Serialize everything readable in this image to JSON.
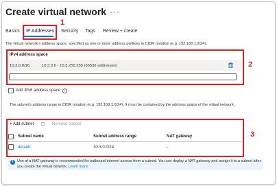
{
  "header": {
    "title": "Create virtual network",
    "more_label": "···"
  },
  "tabs": [
    {
      "label": "Basics",
      "active": false
    },
    {
      "label": "IP Addresses",
      "active": true
    },
    {
      "label": "Security",
      "active": false
    },
    {
      "label": "Tags",
      "active": false
    },
    {
      "label": "Review + create",
      "active": false
    }
  ],
  "annotations": {
    "one": "1",
    "two": "2",
    "three": "3"
  },
  "description": "The virtual network's address space, specified as one or more address prefixes in CIDR notation (e.g. 192.168.1.0/24).",
  "ipv4": {
    "heading": "IPv4 address space",
    "cidr": "10.3.0.0/16",
    "range": "10.3.0.0 - 10.3.255.255 (65536 addresses)",
    "input_value": ""
  },
  "ipv6": {
    "label": "Add IPv6 address space",
    "checked": false
  },
  "subnet_description": "The subnet's address range in CIDR notation (e.g. 192.168.1.0/24). It must be contained by the address space of the virtual network.",
  "subnets": {
    "add_label": "+ Add subnet",
    "remove_label": "Remove subnet",
    "headers": [
      "Subnet name",
      "Subnet address range",
      "NAT gateway"
    ],
    "rows": [
      {
        "name": "default",
        "range": "10.3.0.0/24",
        "nat": "-"
      }
    ]
  },
  "info": {
    "text": "Use of a NAT gateway is recommended for outbound internet access from a subnet. You can deploy a NAT gateway and assign it to a subnet after you create the virtual network.",
    "link": "Learn more"
  },
  "colors": {
    "accent": "#0078d4",
    "annotation": "#e02020",
    "info_bg": "#ebf3fc"
  }
}
